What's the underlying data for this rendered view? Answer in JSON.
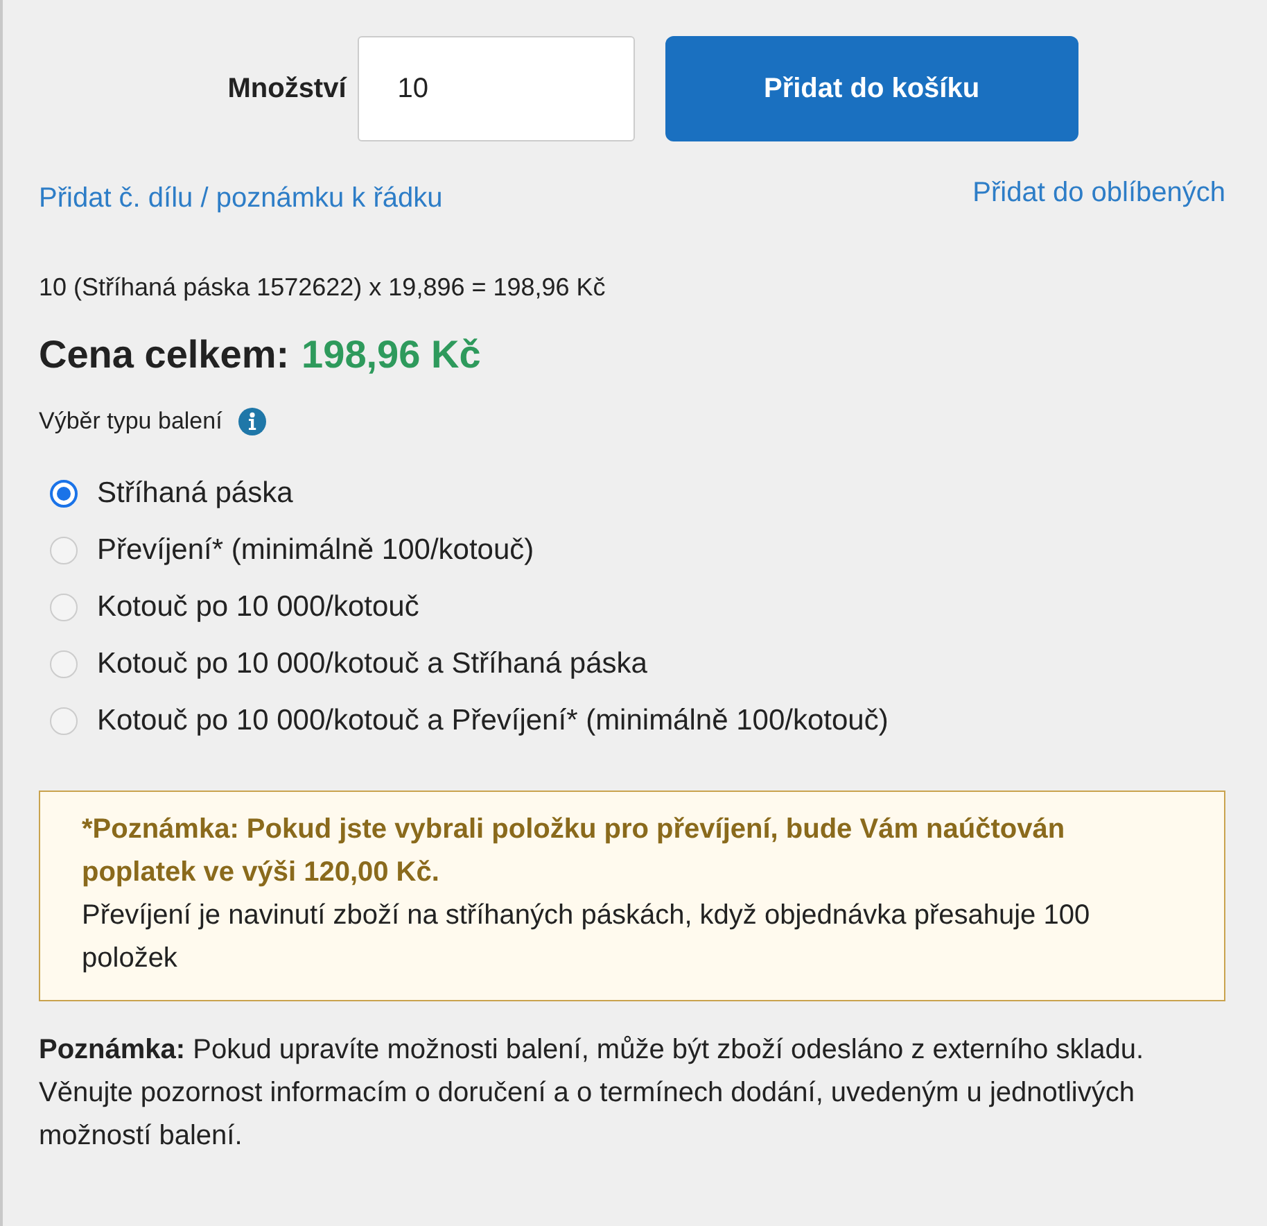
{
  "quantity": {
    "label": "Množství",
    "value": "10"
  },
  "add_to_cart_button": "Přidat do košíku",
  "links": {
    "part_note": "Přidat č. dílu / poznámku k řádku",
    "favorites": "Přidat do oblíbených"
  },
  "calculation": "10 (Stříhaná páska 1572622) x 19,896 = 198,96 Kč",
  "total": {
    "label": "Cena celkem:",
    "value": "198,96 Kč"
  },
  "packaging": {
    "label": "Výběr typu balení",
    "options": [
      {
        "label": "Stříhaná páska",
        "selected": true
      },
      {
        "label": "Převíjení* (minimálně 100/kotouč)",
        "selected": false
      },
      {
        "label": "Kotouč po 10 000/kotouč",
        "selected": false
      },
      {
        "label": "Kotouč po 10 000/kotouč a Stříhaná páska",
        "selected": false
      },
      {
        "label": "Kotouč po 10 000/kotouč a Převíjení* (minimálně 100/kotouč)",
        "selected": false
      }
    ]
  },
  "notice": {
    "warning": "*Poznámka: Pokud jste vybrali položku pro převíjení, bude Vám naúčtován poplatek ve výši 120,00 Kč.",
    "body": "Převíjení je navinutí zboží na stříhaných páskách, když objednávka přesahuje 100 položek"
  },
  "footnote": "**Poznámka:** Pokud upravíte možnosti balení, může být zboží odesláno z externího skladu. Věnujte pozornost informacím o doručení a o termínech dodání, uvedeným u jednotlivých možností balení."
}
